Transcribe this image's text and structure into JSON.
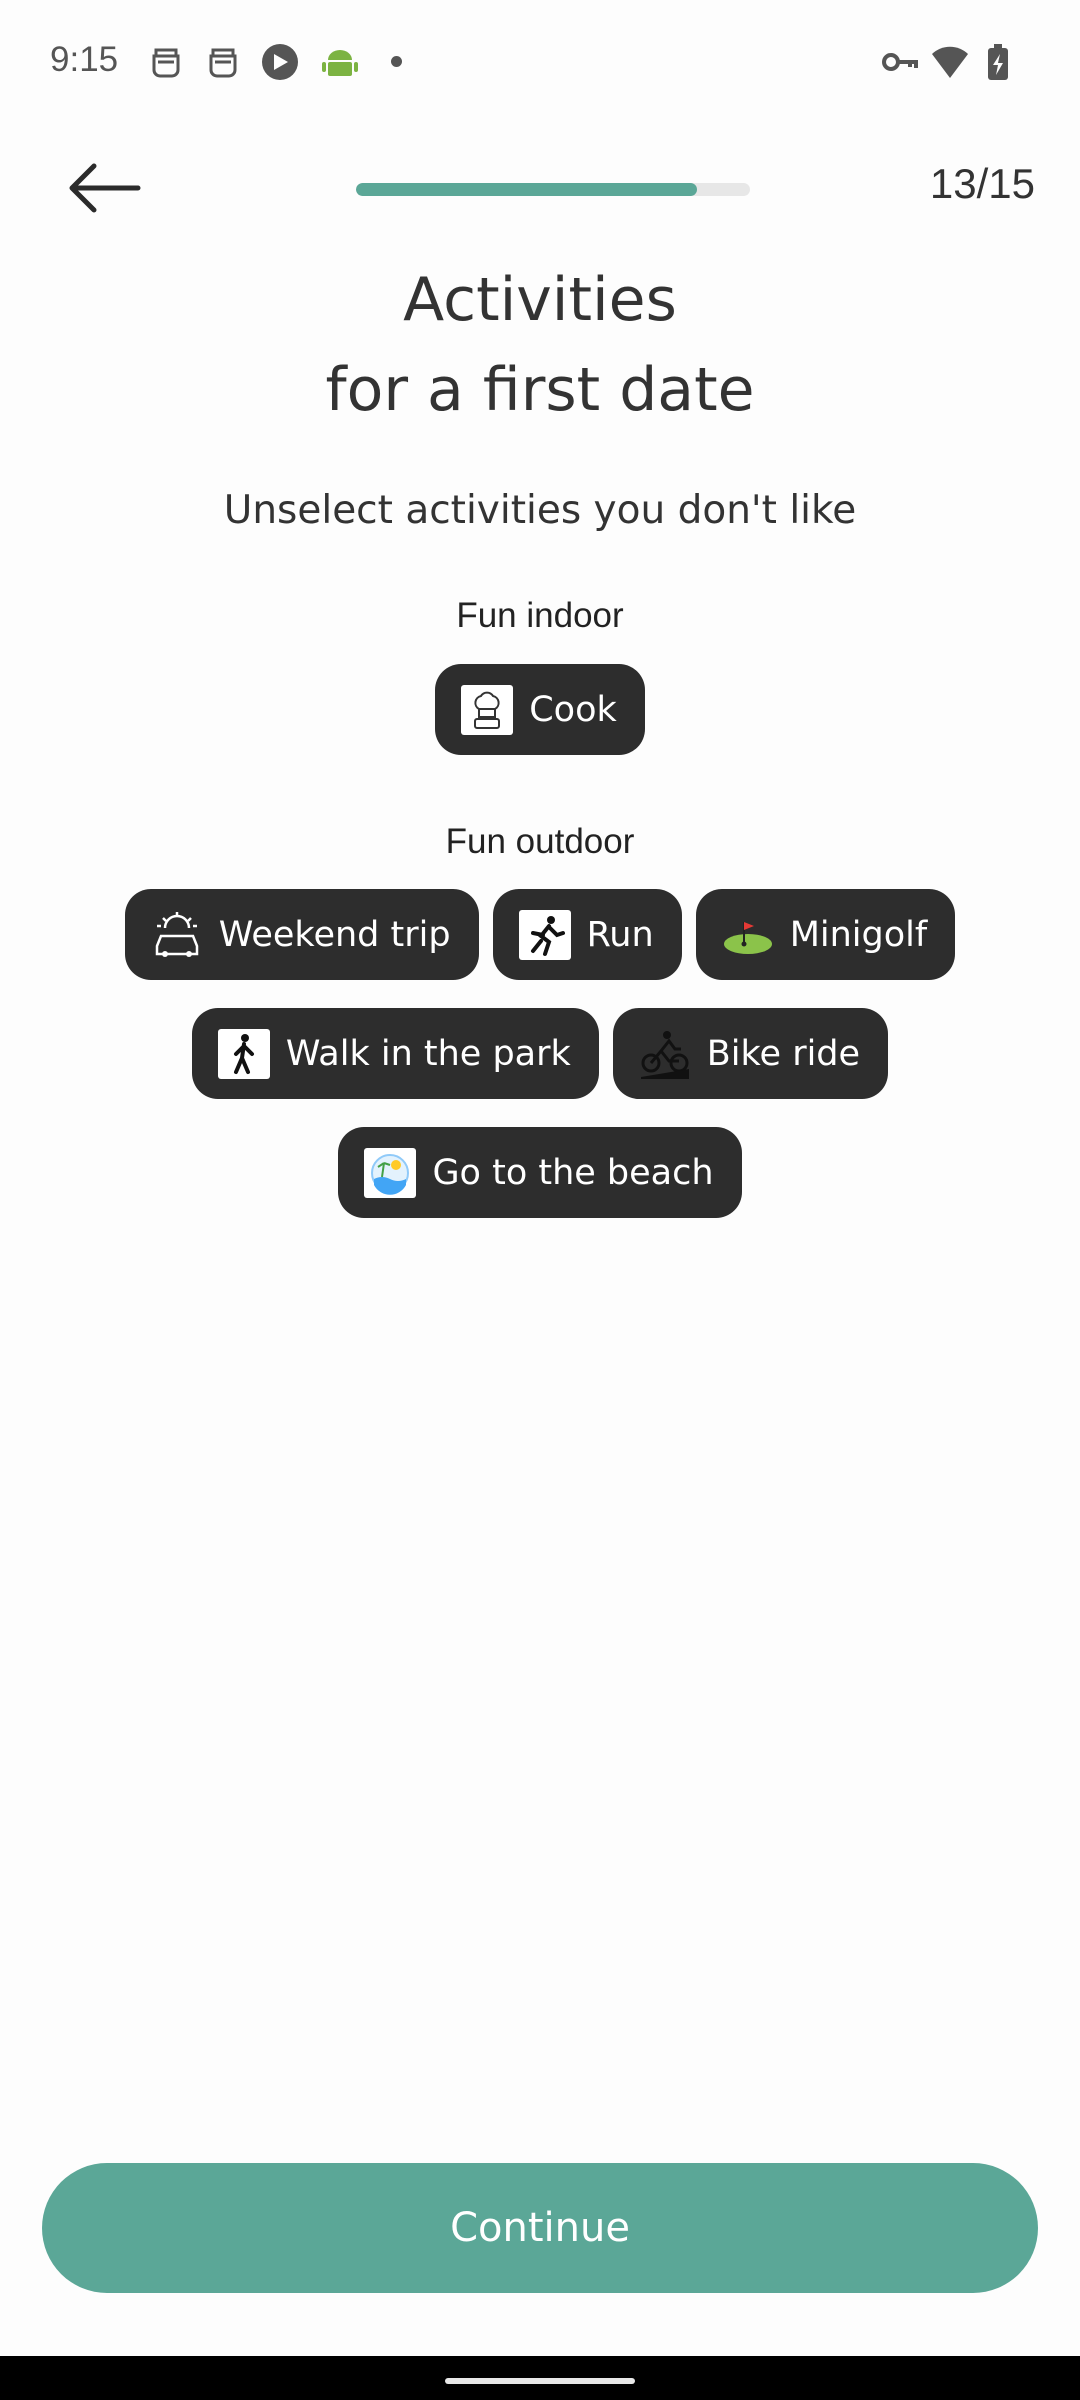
{
  "status_bar": {
    "time": "9:15",
    "icons": [
      "face-robot-icon",
      "face-robot-icon",
      "camera-shutter-icon",
      "android-icon",
      "dot-icon",
      "key-icon",
      "wifi-icon",
      "battery-charging-icon"
    ]
  },
  "header": {
    "back_icon": "arrow-left-icon",
    "progress_fraction": 0.8667,
    "step_counter": "13/15"
  },
  "title": {
    "line1": "Activities",
    "line2": "for a first date"
  },
  "subtitle": "Unselect activities you don't like",
  "sections": [
    {
      "title": "Fun indoor",
      "activities": [
        {
          "label": "Cook",
          "icon": "chef-hat-icon"
        }
      ]
    },
    {
      "title": "Fun outdoor",
      "activities": [
        {
          "label": "Weekend trip",
          "icon": "car-sunrise-icon"
        },
        {
          "label": "Run",
          "icon": "running-person-icon"
        },
        {
          "label": "Minigolf",
          "icon": "golf-green-icon"
        },
        {
          "label": "Walk in the park",
          "icon": "walking-person-icon"
        },
        {
          "label": "Bike ride",
          "icon": "cyclist-icon"
        },
        {
          "label": "Go to the beach",
          "icon": "beach-icon"
        }
      ]
    }
  ],
  "continue_label": "Continue",
  "colors": {
    "accent": "#5ba797",
    "chip_background": "#2d2d2d",
    "chip_text": "#ffffff",
    "progress_track": "#e7e7e7"
  }
}
